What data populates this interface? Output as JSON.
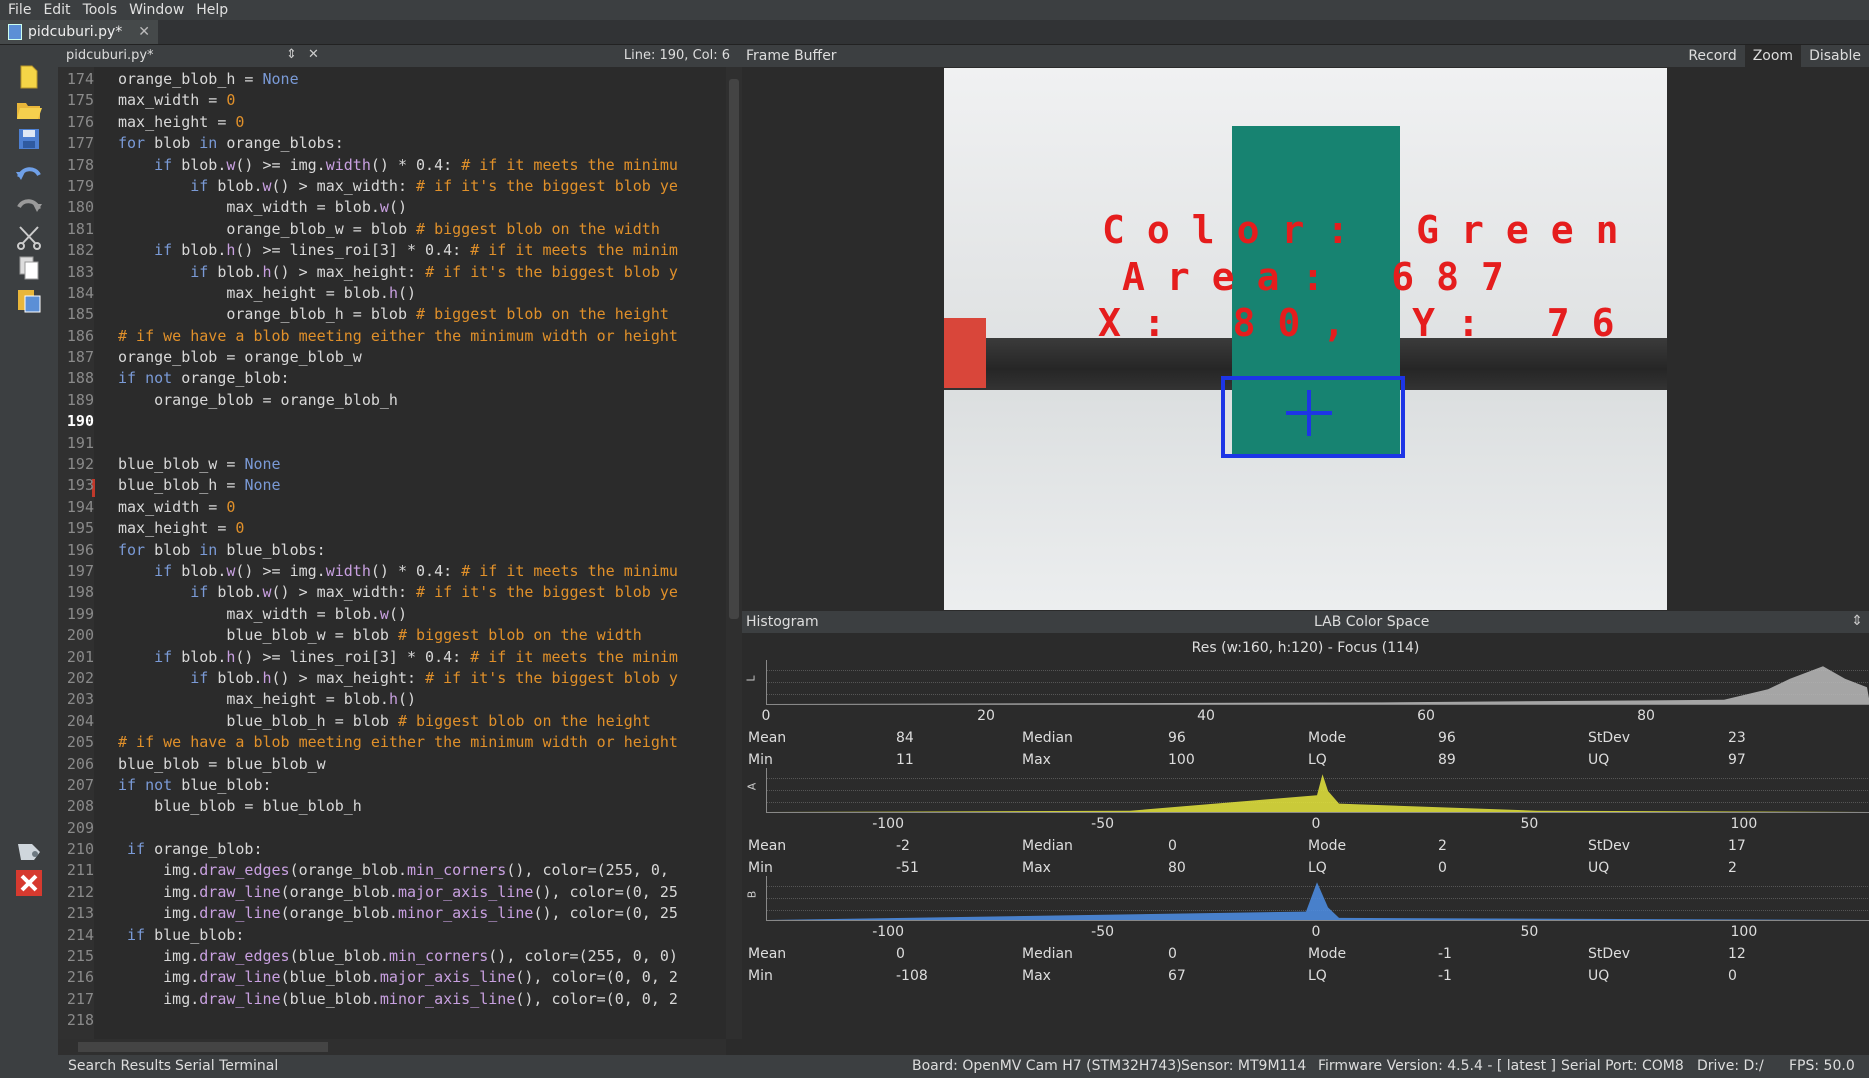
{
  "menu": [
    "File",
    "Edit",
    "Tools",
    "Window",
    "Help"
  ],
  "tab": {
    "title": "pidcuburi.py*",
    "close": "✕"
  },
  "editor": {
    "file": "pidcuburi.py*",
    "cursor": "Line: 190, Col: 6",
    "current_line": "190",
    "lines": [
      {
        "n": "174",
        "html": "orange_blob_h = <span class='kw'>None</span>"
      },
      {
        "n": "175",
        "html": "max_width = <span class='cm'>0</span>"
      },
      {
        "n": "176",
        "html": "max_height = <span class='cm'>0</span>"
      },
      {
        "n": "177",
        "html": "<span class='kw'>for</span> blob <span class='kw'>in</span> orange_blobs:"
      },
      {
        "n": "178",
        "html": "    <span class='kw'>if</span> blob.<span class='fn'>w</span>() >= img.<span class='fn'>width</span>() * 0.4: <span class='cm'># if it meets the minimu</span>"
      },
      {
        "n": "179",
        "html": "        <span class='kw'>if</span> blob.<span class='fn'>w</span>() > max_width: <span class='cm'># if it's the biggest blob ye</span>"
      },
      {
        "n": "180",
        "html": "            max_width = blob.<span class='fn'>w</span>()"
      },
      {
        "n": "181",
        "html": "            orange_blob_w = blob <span class='cm'># biggest blob on the width</span>"
      },
      {
        "n": "182",
        "html": "    <span class='kw'>if</span> blob.<span class='fn'>h</span>() >= lines_roi[3] * 0.4: <span class='cm'># if it meets the minim</span>"
      },
      {
        "n": "183",
        "html": "        <span class='kw'>if</span> blob.<span class='fn'>h</span>() > max_height: <span class='cm'># if it's the biggest blob y</span>"
      },
      {
        "n": "184",
        "html": "            max_height = blob.<span class='fn'>h</span>()"
      },
      {
        "n": "185",
        "html": "            orange_blob_h = blob <span class='cm'># biggest blob on the height</span>"
      },
      {
        "n": "186",
        "html": "<span class='cm'># if we have a blob meeting either the minimum width or height</span>"
      },
      {
        "n": "187",
        "html": "orange_blob = orange_blob_w"
      },
      {
        "n": "188",
        "html": "<span class='kw'>if not</span> orange_blob:"
      },
      {
        "n": "189",
        "html": "    orange_blob = orange_blob_h"
      },
      {
        "n": "190",
        "html": ""
      },
      {
        "n": "191",
        "html": ""
      },
      {
        "n": "192",
        "html": "blue_blob_w = <span class='kw'>None</span>"
      },
      {
        "n": "193",
        "html": "blue_blob_h = <span class='kw'>None</span>"
      },
      {
        "n": "194",
        "html": "max_width = <span class='cm'>0</span>"
      },
      {
        "n": "195",
        "html": "max_height = <span class='cm'>0</span>"
      },
      {
        "n": "196",
        "html": "<span class='kw'>for</span> blob <span class='kw'>in</span> blue_blobs:"
      },
      {
        "n": "197",
        "html": "    <span class='kw'>if</span> blob.<span class='fn'>w</span>() >= img.<span class='fn'>width</span>() * 0.4: <span class='cm'># if it meets the minimu</span>"
      },
      {
        "n": "198",
        "html": "        <span class='kw'>if</span> blob.<span class='fn'>w</span>() > max_width: <span class='cm'># if it's the biggest blob ye</span>"
      },
      {
        "n": "199",
        "html": "            max_width = blob.<span class='fn'>w</span>()"
      },
      {
        "n": "200",
        "html": "            blue_blob_w = blob <span class='cm'># biggest blob on the width</span>"
      },
      {
        "n": "201",
        "html": "    <span class='kw'>if</span> blob.<span class='fn'>h</span>() >= lines_roi[3] * 0.4: <span class='cm'># if it meets the minim</span>"
      },
      {
        "n": "202",
        "html": "        <span class='kw'>if</span> blob.<span class='fn'>h</span>() > max_height: <span class='cm'># if it's the biggest blob y</span>"
      },
      {
        "n": "203",
        "html": "            max_height = blob.<span class='fn'>h</span>()"
      },
      {
        "n": "204",
        "html": "            blue_blob_h = blob <span class='cm'># biggest blob on the height</span>"
      },
      {
        "n": "205",
        "html": "<span class='cm'># if we have a blob meeting either the minimum width or height</span>"
      },
      {
        "n": "206",
        "html": "blue_blob = blue_blob_w"
      },
      {
        "n": "207",
        "html": "<span class='kw'>if not</span> blue_blob:"
      },
      {
        "n": "208",
        "html": "    blue_blob = blue_blob_h"
      },
      {
        "n": "209",
        "html": ""
      },
      {
        "n": "210",
        "html": " <span class='kw'>if</span> orange_blob:"
      },
      {
        "n": "211",
        "html": "     img.<span class='fn'>draw_edges</span>(orange_blob.<span class='fn'>min_corners</span>(), color=(255, 0,"
      },
      {
        "n": "212",
        "html": "     img.<span class='fn'>draw_line</span>(orange_blob.<span class='fn'>major_axis_line</span>(), color=(0, 25"
      },
      {
        "n": "213",
        "html": "     img.<span class='fn'>draw_line</span>(orange_blob.<span class='fn'>minor_axis_line</span>(), color=(0, 25"
      },
      {
        "n": "214",
        "html": " <span class='kw'>if</span> blue_blob:"
      },
      {
        "n": "215",
        "html": "     img.<span class='fn'>draw_edges</span>(blue_blob.<span class='fn'>min_corners</span>(), color=(255, 0, 0)"
      },
      {
        "n": "216",
        "html": "     img.<span class='fn'>draw_line</span>(blue_blob.<span class='fn'>major_axis_line</span>(), color=(0, 0, 2"
      },
      {
        "n": "217",
        "html": "     img.<span class='fn'>draw_line</span>(blue_blob.<span class='fn'>minor_axis_line</span>(), color=(0, 0, 2"
      },
      {
        "n": "218",
        "html": ""
      }
    ]
  },
  "framebuffer": {
    "title": "Frame Buffer",
    "buttons": [
      "Record",
      "Zoom",
      "Disable"
    ],
    "overlay": {
      "line1": "Color: Green",
      "line2": "Area: 687",
      "line3": "X: 80, Y: 76"
    }
  },
  "histogram": {
    "title": "Histogram",
    "colorspace": "LAB Color Space",
    "resolution": "Res (w:160, h:120) - Focus (114)",
    "channels": [
      {
        "axis": "L",
        "ticks": [
          "0",
          "20",
          "40",
          "60",
          "80"
        ],
        "mean": "84",
        "median": "96",
        "mode": "96",
        "stdev": "23",
        "min": "11",
        "max": "100",
        "lq": "89",
        "uq": "97"
      },
      {
        "axis": "A",
        "ticks": [
          "-100",
          "-50",
          "0",
          "50",
          "100"
        ],
        "mean": "-2",
        "median": "0",
        "mode": "2",
        "stdev": "17",
        "min": "-51",
        "max": "80",
        "lq": "0",
        "uq": "2"
      },
      {
        "axis": "B",
        "ticks": [
          "-100",
          "-50",
          "0",
          "50",
          "100"
        ],
        "mean": "0",
        "median": "0",
        "mode": "-1",
        "stdev": "12",
        "min": "-108",
        "max": "67",
        "lq": "-1",
        "uq": "0"
      }
    ],
    "labels": {
      "mean": "Mean",
      "median": "Median",
      "mode": "Mode",
      "stdev": "StDev",
      "min": "Min",
      "max": "Max",
      "lq": "LQ",
      "uq": "UQ"
    }
  },
  "bottom": {
    "search": "Search Results",
    "serial": "Serial Terminal",
    "board": "Board: OpenMV Cam H7 (STM32H743)",
    "sensor": "Sensor: MT9M114",
    "firmware": "Firmware Version: 4.5.4 - [ latest ]",
    "port": "Serial Port: COM8",
    "drive": "Drive: D:/",
    "fps": "FPS: 50.0"
  }
}
